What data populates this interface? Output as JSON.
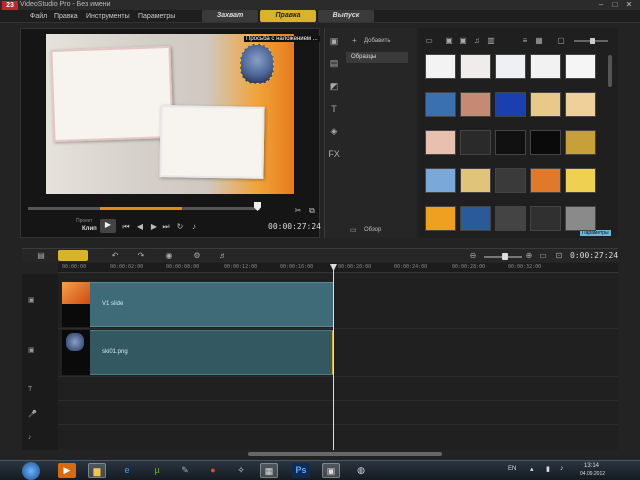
{
  "app": {
    "logo_text": "23",
    "title": "VideoStudio Pro - Без имени",
    "window_controls": [
      "–",
      "□",
      "✕"
    ]
  },
  "menu": {
    "items": [
      "Файл",
      "Правка",
      "Инструменты",
      "Параметры"
    ],
    "steps": [
      "Захват",
      "Правка",
      "Выпуск"
    ],
    "active_step": "Правка"
  },
  "preview": {
    "overlay_title": "Просьба с наложением ...",
    "mode_project": "Проект",
    "mode_clip": "Клип",
    "timecode": "00:00:27:24",
    "controls": [
      "play-icon",
      "start-icon",
      "prev-frame-icon",
      "next-frame-icon",
      "end-icon",
      "repeat-icon",
      "volume-icon"
    ]
  },
  "library": {
    "add_label": "Добавить",
    "folder_label": "Образцы",
    "browse_label": "Обзор",
    "options_label": "Параметры",
    "side_icons": [
      "media-icon",
      "instant-project-icon",
      "transition-icon",
      "title-icon",
      "graphic-icon",
      "filter-icon"
    ],
    "thumbnail_colors": [
      [
        "#f3f3f3",
        "#f0ecec",
        "#eef0f4",
        "#f2f2f2",
        "#f5f5f5"
      ],
      [
        "#3a6fb0",
        "#c48a73",
        "#1c3fb0",
        "#e8c98a",
        "#f0d09a"
      ],
      [
        "#e8c0b0",
        "#2a2a2a",
        "#111111",
        "#0a0a0a",
        "#c8a03a"
      ],
      [
        "#7aa8d8",
        "#e0c47a",
        "#3a3a3a",
        "#e07a2a",
        "#f0d050"
      ],
      [
        "#f0a020",
        "#2a5a9a",
        "#444444",
        "#303030",
        "#8a8a8a"
      ]
    ]
  },
  "timeline": {
    "timecode": "0:00:27:24",
    "ruler_ticks": [
      "00:00:00",
      "00:00:02:00",
      "00:00:08:00",
      "00:00:12:00",
      "00:00:16:00",
      "00:00:20:00",
      "00:00:24:00",
      "00:00:28:00",
      "00:00:32:00"
    ],
    "video_clip": "V1 slide",
    "overlay_clip": "ski01.png",
    "track_icons": [
      "video-track-icon",
      "overlay-track-icon",
      "title-track-icon",
      "voice-track-icon",
      "music-track-icon"
    ]
  },
  "taskbar": {
    "language": "EN",
    "time": "13:14",
    "date": "04.09.2012",
    "apps": [
      "media-player-icon",
      "folder-icon",
      "ie-icon",
      "utorrent-icon",
      "tool-icon",
      "chrome-icon",
      "videostudio-icon",
      "photoshop-icon",
      "video-icon",
      "app-icon"
    ]
  }
}
